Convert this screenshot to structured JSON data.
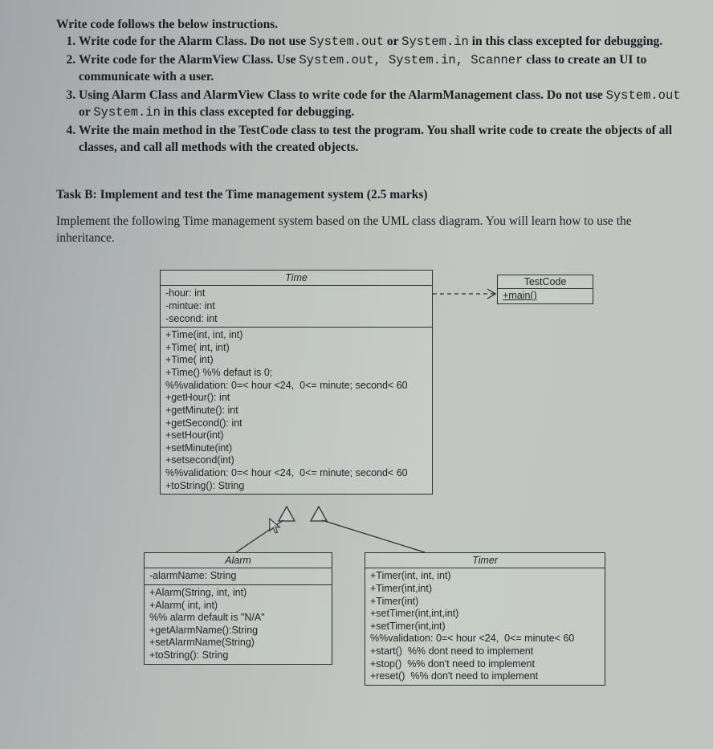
{
  "intro": "Write code follows the below instructions.",
  "items": {
    "i1a": "Write code for the Alarm Class. Do not use ",
    "i1b": "System.out",
    "i1c": " or ",
    "i1d": "System.in",
    "i1e": " in this class excepted for debugging.",
    "i2a": "Write code for the AlarmView Class. Use ",
    "i2b": "System.out, System.in, Scanner",
    "i2c": " class to create an UI to communicate with a user.",
    "i3a": "Using Alarm Class and AlarmView Class to write code for the AlarmManagement class. Do not use ",
    "i3b": "System.out",
    "i3c": " or ",
    "i3d": "System.in",
    "i3e": " in this class excepted for debugging.",
    "i4": "Write the main method in the TestCode class to test the program. You shall write code to create the objects of all classes, and call all methods with the created objects."
  },
  "taskb": "Task B: Implement and test the Time management system (2.5 marks)",
  "desc": "Implement the following Time management system based on the UML class diagram. You will learn how to use the inheritance.",
  "uml": {
    "time": {
      "title": "Time",
      "attrs": {
        "a1": "-hour: int",
        "a2": "-mintue: int",
        "a3": "-second: int"
      },
      "ops": {
        "o1": "+Time(int, int, int)",
        "o2": "+Time( int, int)",
        "o3": "+Time( int)",
        "o4": "+Time() %% defaut is 0;",
        "o5": "%%validation: 0=< hour <24,  0<= minute; second< 60",
        "o6": "+getHour(): int",
        "o7": "+getMinute(): int",
        "o8": "+getSecond(): int",
        "o9": "+setHour(int)",
        "o10": "+setMinute(int)",
        "o11": "+setsecond(int)",
        "o12": "%%validation: 0=< hour <24,  0<= minute; second< 60",
        "o13": "+toString(): String"
      }
    },
    "testcode": {
      "title": "TestCode",
      "main": "+main()"
    },
    "alarm": {
      "title": "Alarm",
      "attrs": {
        "a1": "-alarmName: String"
      },
      "ops": {
        "o1": "+Alarm(String, int, int)",
        "o2": "+Alarm( int, int)",
        "o3": "%% alarm default is \"N/A\"",
        "o4": "+getAlarmName():String",
        "o5": "+setAlarmName(String)",
        "o6": "+toString(): String"
      }
    },
    "timer": {
      "title": "Timer",
      "ops": {
        "o1": "+Timer(int, int, int)",
        "o2": "+Timer(int,int)",
        "o3": "+Timer(int)",
        "o4": "+setTimer(int,int,int)",
        "o5": "+setTimer(int,int)",
        "o6": "%%validation: 0=< hour <24,  0<= minute< 60",
        "o7": "+start()  %% dont need to implement",
        "o8": "+stop()  %% don't need to implement",
        "o9": "+reset()  %% don't need to implement"
      }
    }
  }
}
